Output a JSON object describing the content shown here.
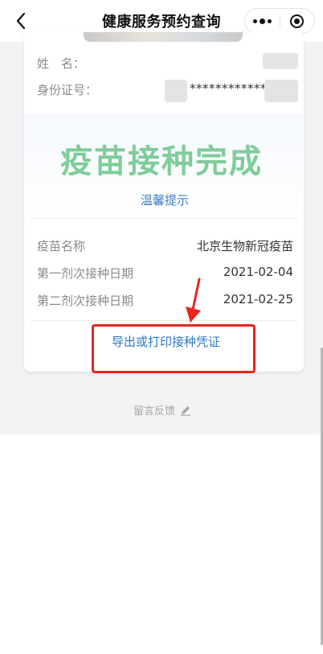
{
  "nav": {
    "title": "健康服务预约查询",
    "back_icon": "chevron-left-icon",
    "more_icon": "more-dots-icon",
    "close_icon": "mini-program-close-icon"
  },
  "person": {
    "name_label": "姓　名：",
    "id_label": "身份证号：",
    "id_masked": "************"
  },
  "status": {
    "title": "疫苗接种完成",
    "tip_link": "温馨提示",
    "color": "#7fcc9a"
  },
  "details": [
    {
      "label": "疫苗名称",
      "value": "北京生物新冠疫苗"
    },
    {
      "label": "第一剂次接种日期",
      "value": "2021-02-04"
    },
    {
      "label": "第二剂次接种日期",
      "value": "2021-02-25"
    }
  ],
  "actions": {
    "export_label": "导出或打印接种凭证",
    "link_color": "#2f78c4"
  },
  "footer": {
    "feedback_label": "留言反馈",
    "feedback_icon": "pencil-icon"
  },
  "annotation": {
    "highlight_color": "#e8251f"
  }
}
